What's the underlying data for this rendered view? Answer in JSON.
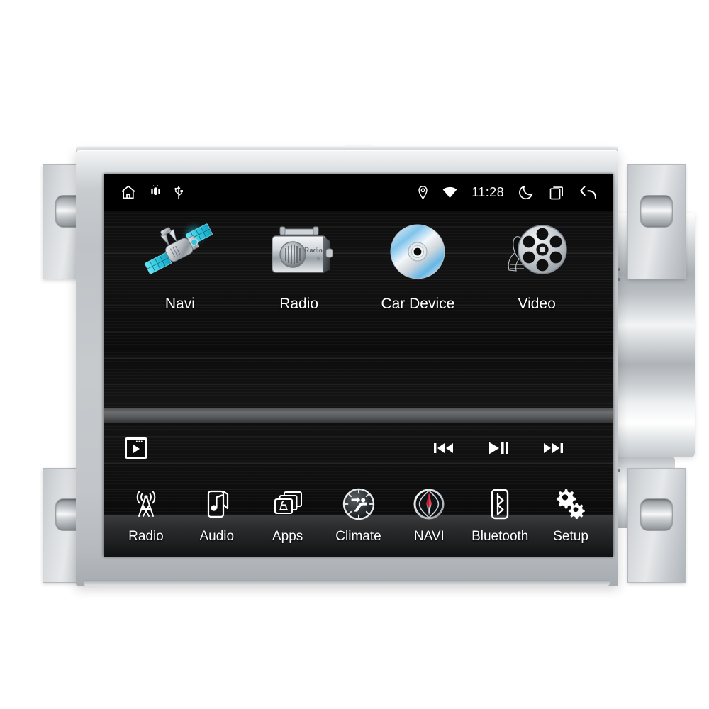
{
  "device": {
    "type": "car-head-unit",
    "bezel_color": "#c6cacd",
    "screen_bg": "#0a0a0a"
  },
  "status_bar": {
    "left_icons": [
      {
        "name": "home-icon",
        "label": "Home"
      },
      {
        "name": "android-icon",
        "label": "Android"
      },
      {
        "name": "usb-icon",
        "label": "USB"
      }
    ],
    "right_icons": [
      {
        "name": "location-pin-icon",
        "label": "Location"
      },
      {
        "name": "wifi-icon",
        "label": "Wi-Fi"
      }
    ],
    "clock": "11:28",
    "trailing_icons": [
      {
        "name": "moon-icon",
        "label": "Night mode"
      },
      {
        "name": "recents-icon",
        "label": "Recent apps"
      },
      {
        "name": "back-arrow-icon",
        "label": "Back"
      }
    ]
  },
  "app_grid": [
    {
      "label": "Navi",
      "icon": "satellite-icon"
    },
    {
      "label": "Radio",
      "icon": "radio-receiver-icon"
    },
    {
      "label": "Car Device",
      "icon": "cd-disc-icon"
    },
    {
      "label": "Video",
      "icon": "film-reel-icon"
    }
  ],
  "media_bar": {
    "launcher_icon": "video-window-play-icon",
    "controls": [
      {
        "name": "previous-track-button",
        "label": "Previous"
      },
      {
        "name": "play-pause-button",
        "label": "Play / Pause"
      },
      {
        "name": "next-track-button",
        "label": "Next"
      }
    ]
  },
  "dock": [
    {
      "label": "Radio",
      "icon": "radio-tower-icon"
    },
    {
      "label": "Audio",
      "icon": "phone-music-note-icon"
    },
    {
      "label": "Apps",
      "icon": "stacked-cards-icon"
    },
    {
      "label": "Climate",
      "icon": "climate-seat-airflow-icon"
    },
    {
      "label": "NAVI",
      "icon": "compass-icon"
    },
    {
      "label": "Bluetooth",
      "icon": "bluetooth-icon"
    },
    {
      "label": "Setup",
      "icon": "gears-icon"
    }
  ],
  "brackets": [
    {
      "name": "mounting-bracket-top-left"
    },
    {
      "name": "mounting-bracket-bottom-left"
    },
    {
      "name": "mounting-bracket-top-right"
    },
    {
      "name": "mounting-bracket-bottom-right"
    }
  ]
}
